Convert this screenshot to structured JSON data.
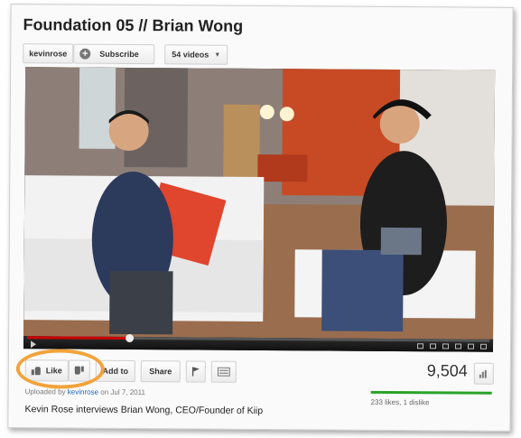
{
  "header": {
    "title": "Foundation 05 // Brian Wong",
    "channel_name": "kevinrose",
    "subscribe_label": "Subscribe",
    "videos_label": "54 videos"
  },
  "player": {
    "progress_fraction": 0.22,
    "colors": {
      "progress": "#cc0000",
      "controls_bg": "#1a1a1a"
    }
  },
  "actions": {
    "like_label": "Like",
    "add_to_label": "Add to",
    "share_label": "Share",
    "views": "9,504"
  },
  "meta": {
    "uploaded_prefix": "Uploaded by",
    "uploader": "kevinrose",
    "uploaded_date": "on Jul 7, 2011",
    "description": "Kevin Rose interviews Brian Wong, CEO/Founder of Kiip",
    "likes_summary": "233 likes, 1 dislike"
  },
  "icons": {
    "subscribe": "plus-circle-icon",
    "videos": "caret-down-icon",
    "like": "thumbs-up-icon",
    "dislike": "thumbs-down-icon",
    "flag": "flag-icon",
    "transcript": "transcript-icon",
    "stats": "bar-chart-icon"
  },
  "accents": {
    "highlight_oval": "#f2a33a",
    "like_bar": "#2aa32a",
    "link": "#1c62b9"
  }
}
